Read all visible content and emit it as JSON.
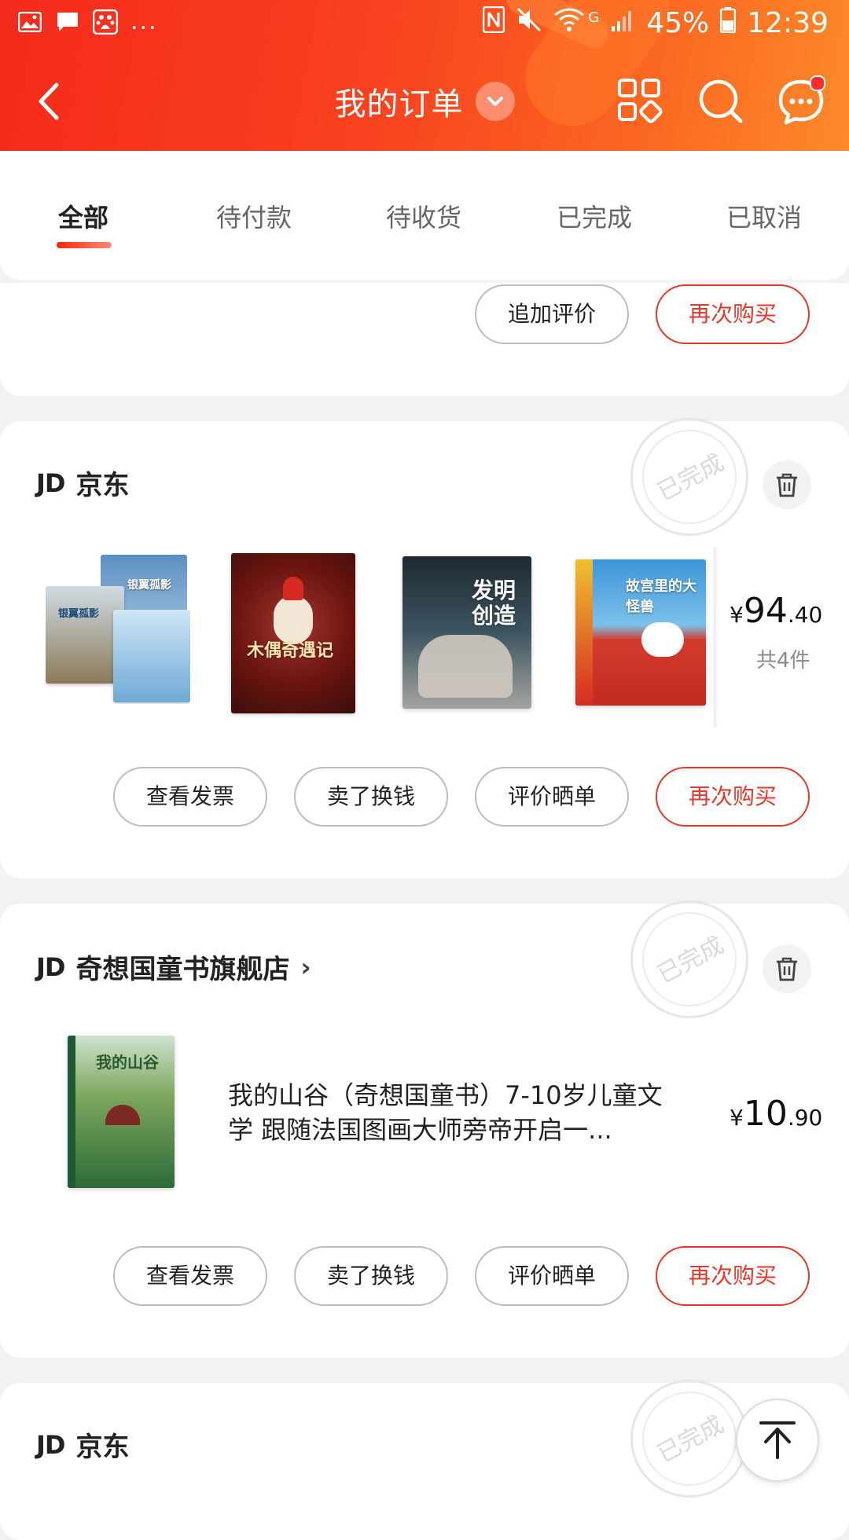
{
  "status_bar": {
    "notification_more": "...",
    "battery": "45%",
    "time": "12:39",
    "network": "G"
  },
  "header": {
    "title": "我的订单"
  },
  "tabs": [
    {
      "label": "全部",
      "active": true
    },
    {
      "label": "待付款",
      "active": false
    },
    {
      "label": "待收货",
      "active": false
    },
    {
      "label": "已完成",
      "active": false
    },
    {
      "label": "已取消",
      "active": false
    }
  ],
  "order0": {
    "buttons": [
      "追加评价",
      "再次购买"
    ]
  },
  "order1": {
    "shop": "京东",
    "logo": "JD",
    "stamp": "已完成",
    "books": [
      {
        "title": "银翼孤影",
        "colors": [
          "#6aa0c8",
          "#cfe2f0"
        ]
      },
      {
        "title": "木偶奇遇记",
        "colors": [
          "#7a1a18",
          "#3a1a12"
        ]
      },
      {
        "title": "发明创造",
        "colors": [
          "#2a3a44",
          "#6c8a98"
        ]
      },
      {
        "title": "故宫里的大怪兽",
        "colors": [
          "#2f8ad0",
          "#d62a22"
        ]
      }
    ],
    "price": {
      "currency": "¥",
      "integer": "94",
      "decimal": ".40"
    },
    "count": "共4件",
    "buttons": [
      "查看发票",
      "卖了换钱",
      "评价晒单",
      "再次购买"
    ]
  },
  "order2": {
    "shop": "奇想国童书旗舰店",
    "logo": "JD",
    "stamp": "已完成",
    "book": {
      "title": "我的山谷",
      "colors": [
        "#2d6b3a",
        "#8fb05a"
      ]
    },
    "item_name": "我的山谷（奇想国童书）7-10岁儿童文学 跟随法国图画大师旁帝开启一...",
    "price": {
      "currency": "¥",
      "integer": "10",
      "decimal": ".90"
    },
    "buttons": [
      "查看发票",
      "卖了换钱",
      "评价晒单",
      "再次购买"
    ]
  },
  "order3": {
    "shop": "京东",
    "logo": "JD",
    "stamp": "已完成"
  },
  "colors": {
    "brand_red": "#e4392b",
    "header_start": "#f52a1c",
    "header_end": "#fd8a2a"
  }
}
